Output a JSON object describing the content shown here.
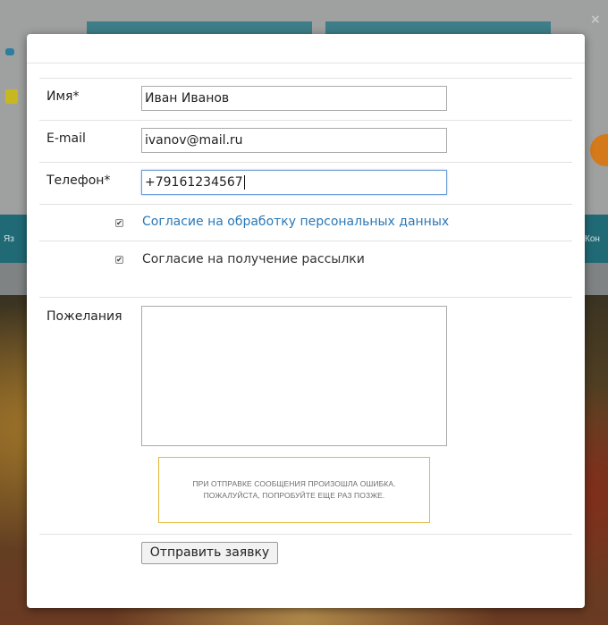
{
  "background": {
    "nav_left_text": "Яз",
    "nav_right_text": "Кон",
    "close_glyph": "×"
  },
  "form": {
    "name": {
      "label": "Имя*",
      "value": "Иван Иванов"
    },
    "email": {
      "label": "E-mail",
      "value": "ivanov@mail.ru"
    },
    "phone": {
      "label": "Телефон*",
      "value": "+79161234567"
    },
    "consent_personal": {
      "checked": true,
      "label": "Согласие на обработку персональных данных"
    },
    "consent_newsletter": {
      "checked": true,
      "label": "Согласие на получение рассылки"
    },
    "wishes": {
      "label": "Пожелания",
      "value": ""
    },
    "error": {
      "line1": "ПРИ ОТПРАВКЕ СООБЩЕНИЯ ПРОИЗОШЛА ОШИБКА.",
      "line2": "ПОЖАЛУЙСТА, ПОПРОБУЙТЕ ЕЩЕ РАЗ ПОЗЖЕ.",
      "border_color": "#e5b83a"
    },
    "submit_label": "Отправить заявку"
  },
  "colors": {
    "link": "#2b78b6",
    "focus": "#6b9ed8"
  },
  "icons": {
    "checkmark": "✔"
  }
}
